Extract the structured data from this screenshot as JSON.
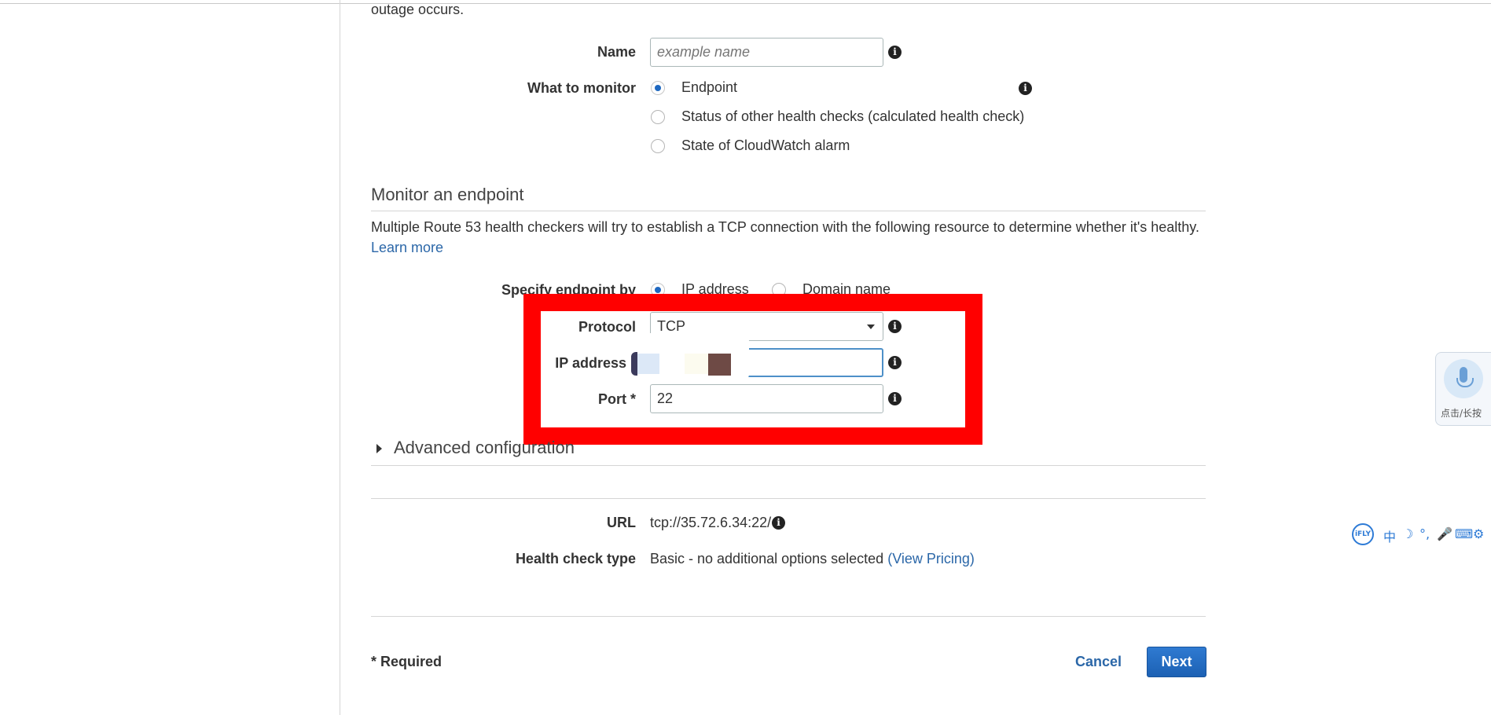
{
  "intro_tail": "outage occurs.",
  "form": {
    "name_label": "Name",
    "name_placeholder": "example name",
    "monitor_label": "What to monitor",
    "monitor_options": [
      "Endpoint",
      "Status of other health checks (calculated health check)",
      "State of CloudWatch alarm"
    ],
    "monitor_selected": "Endpoint"
  },
  "endpoint_section": {
    "title": "Monitor an endpoint",
    "description": "Multiple Route 53 health checkers will try to establish a TCP connection with the following resource to determine whether it's healthy.",
    "learn_more": "Learn more",
    "specify_label": "Specify endpoint by",
    "specify_options": [
      "IP address",
      "Domain name"
    ],
    "specify_selected": "IP address",
    "protocol_label": "Protocol",
    "protocol_value": "TCP",
    "ip_label": "IP address",
    "ip_value": "",
    "port_label": "Port *",
    "port_value": "22"
  },
  "advanced": {
    "label": "Advanced configuration"
  },
  "summary": {
    "url_label": "URL",
    "url_value": "tcp://35.72.6.34:22/",
    "type_label": "Health check type",
    "type_value": "Basic - no additional options selected",
    "view_pricing": "(View Pricing)"
  },
  "footer": {
    "required_note": "* Required",
    "cancel": "Cancel",
    "next": "Next"
  },
  "widgets": {
    "voice_label": "点击/长按",
    "ifly_logo": "iFLY",
    "ifly_icons": [
      "中",
      "☽",
      "°,",
      "🎤",
      "⌨",
      "⚙"
    ]
  },
  "colors": {
    "highlight_frame": "#ff0000",
    "link": "#2b67a8",
    "primary_button": "#1f68c0"
  }
}
